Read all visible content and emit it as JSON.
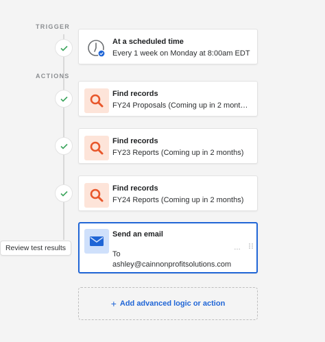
{
  "sections": {
    "trigger_label": "TRIGGER",
    "actions_label": "ACTIONS"
  },
  "trigger": {
    "title": "At a scheduled time",
    "subtitle": "Every 1 week on Monday at 8:00am EDT",
    "icon": "clock-icon"
  },
  "actions": [
    {
      "title": "Find records",
      "subtitle": "FY24 Proposals (Coming up in 2 mont…",
      "icon": "search-icon"
    },
    {
      "title": "Find records",
      "subtitle": "FY23 Reports (Coming up in 2 months)",
      "icon": "search-icon"
    },
    {
      "title": "Find records",
      "subtitle": "FY24 Reports (Coming up in 2 months)",
      "icon": "search-icon"
    }
  ],
  "email_action": {
    "title": "Send an email",
    "line1": "To",
    "line2": "ashley@cainnonprofitsolutions.com",
    "icon": "envelope-icon",
    "more": "…"
  },
  "review_button": "Review test results",
  "add_action": {
    "plus": "+",
    "label": "Add advanced logic or action"
  },
  "colors": {
    "accent": "#1f65d6",
    "search_bg": "#fde4d9",
    "search_fg": "#e8562a",
    "check": "#3ba55c"
  }
}
